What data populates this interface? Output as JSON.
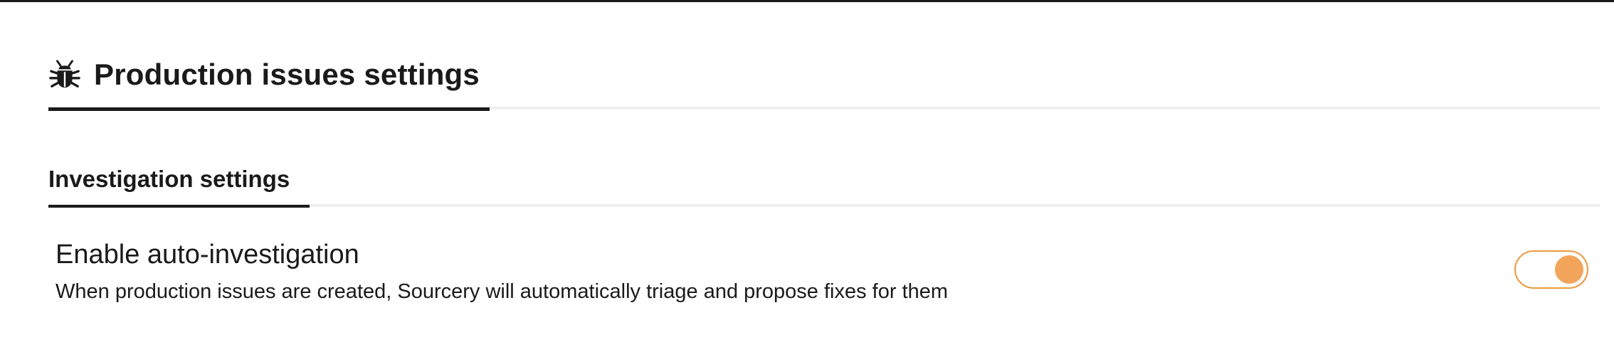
{
  "section": {
    "icon": "bug-icon",
    "title": "Production issues settings"
  },
  "subsection": {
    "title": "Investigation settings"
  },
  "setting": {
    "title": "Enable auto-investigation",
    "description": "When production issues are created, Sourcery will automatically triage and propose fixes for them",
    "enabled": true
  },
  "colors": {
    "accent": "#ee9a3e",
    "knob": "#f2a45a",
    "text": "#1a1a1a",
    "divider": "#efefef"
  }
}
